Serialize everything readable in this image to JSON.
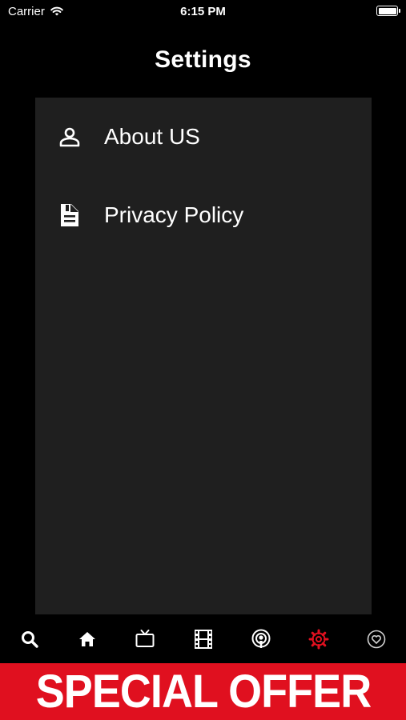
{
  "status_bar": {
    "carrier": "Carrier",
    "time": "6:15 PM"
  },
  "header": {
    "title": "Settings"
  },
  "settings_menu": {
    "items": [
      {
        "label": "About US",
        "icon": "person-icon"
      },
      {
        "label": "Privacy Policy",
        "icon": "document-icon"
      }
    ]
  },
  "tab_bar": {
    "tabs": [
      {
        "icon": "search-icon",
        "active": false
      },
      {
        "icon": "home-icon",
        "active": false
      },
      {
        "icon": "tv-icon",
        "active": false
      },
      {
        "icon": "film-icon",
        "active": false
      },
      {
        "icon": "podcast-icon",
        "active": false
      },
      {
        "icon": "gear-icon",
        "active": true
      },
      {
        "icon": "heart-icon",
        "active": false
      }
    ],
    "active_color": "#e0101f",
    "inactive_color": "#ffffff"
  },
  "banner": {
    "text": "SPECIAL OFFER",
    "background": "#e0101f"
  },
  "colors": {
    "background": "#000000",
    "panel": "#1f1f1f"
  }
}
